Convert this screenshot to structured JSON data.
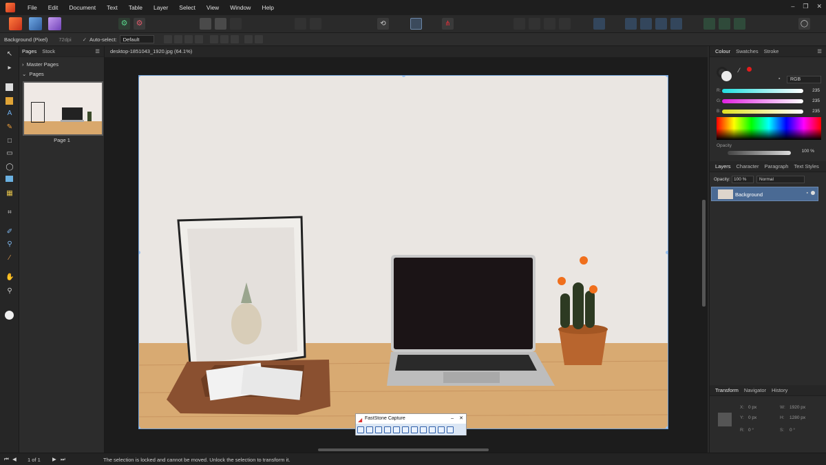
{
  "menu": [
    "File",
    "Edit",
    "Document",
    "Text",
    "Table",
    "Layer",
    "Select",
    "View",
    "Window",
    "Help"
  ],
  "window_controls": [
    "–",
    "❐",
    "✕"
  ],
  "context": {
    "layer_name": "Background (Pixel)",
    "dpi": "72dpi",
    "auto_select_label": "Auto-select:",
    "auto_select_value": "Default"
  },
  "pages_panel": {
    "tabs": [
      "Pages",
      "Stock"
    ],
    "master_pages": "Master Pages",
    "pages": "Pages",
    "page_label": "Page 1"
  },
  "document": {
    "tab_title": "desktop-1851043_1920.jpg (64.1%)"
  },
  "colour_panel": {
    "tabs": [
      "Colour",
      "Swatches",
      "Stroke"
    ],
    "model": "RGB",
    "r_label": "R:",
    "r_value": "235",
    "g_label": "G:",
    "g_value": "235",
    "b_label": "B:",
    "b_value": "235",
    "opacity_label": "Opacity",
    "opacity_value": "100 %",
    "accent": "#e41c1c"
  },
  "layers_panel": {
    "tabs": [
      "Layers",
      "Character",
      "Paragraph",
      "Text Styles"
    ],
    "opacity_label": "Opacity:",
    "opacity_value": "100 %",
    "blend_mode": "Normal",
    "layer_name": "Background",
    "selected_color": "#4a6a94"
  },
  "transform_panel": {
    "tabs": [
      "Transform",
      "Navigator",
      "History"
    ],
    "x_label": "X:",
    "x_value": "0 px",
    "y_label": "Y:",
    "y_value": "0 px",
    "w_label": "W:",
    "w_value": "1920 px",
    "h_label": "H:",
    "h_value": "1280 px",
    "r_label": "R:",
    "r_value": "0 °",
    "s_label": "S:",
    "s_value": "0 °"
  },
  "status": {
    "page_count": "1 of 1",
    "message": "The selection is locked and cannot be moved. Unlock the selection to transform it."
  },
  "faststone": {
    "title": "FastStone Capture",
    "min": "–",
    "close": "✕"
  }
}
